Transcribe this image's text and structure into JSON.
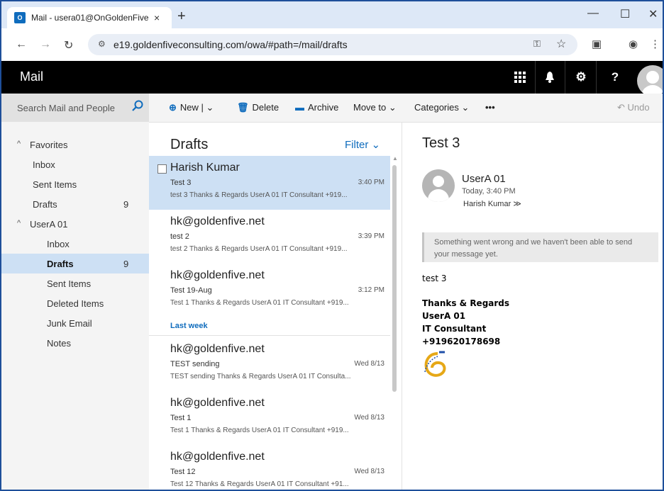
{
  "browser": {
    "tab_title": "Mail - usera01@OnGoldenFive",
    "tab_favicon_text": "O",
    "new_tab": "+",
    "close_tab": "×",
    "window_controls": [
      "—",
      "☐",
      "✕"
    ],
    "url": "e19.goldenfiveconsulting.com/owa/#path=/mail/drafts"
  },
  "app": {
    "brand": "Mail",
    "header_icons": [
      "apps-icon",
      "bell-icon",
      "gear-icon",
      "help-icon"
    ],
    "help_label": "?"
  },
  "search": {
    "placeholder": "Search Mail and People"
  },
  "folders": {
    "favorites_label": "Favorites",
    "favorites": [
      {
        "label": "Inbox",
        "count": ""
      },
      {
        "label": "Sent Items",
        "count": ""
      },
      {
        "label": "Drafts",
        "count": "9"
      }
    ],
    "account_label": "UserA 01",
    "account_folders": [
      {
        "label": "Inbox",
        "count": ""
      },
      {
        "label": "Drafts",
        "count": "9"
      },
      {
        "label": "Sent Items",
        "count": ""
      },
      {
        "label": "Deleted Items",
        "count": ""
      },
      {
        "label": "Junk Email",
        "count": ""
      },
      {
        "label": "Notes",
        "count": ""
      }
    ]
  },
  "commands": {
    "new": "New",
    "delete": "Delete",
    "archive": "Archive",
    "move_to": "Move to",
    "categories": "Categories",
    "more": "•••",
    "undo": "Undo"
  },
  "list": {
    "title": "Drafts",
    "filter": "Filter",
    "group_last_week": "Last week",
    "messages": [
      {
        "sender": "Harish Kumar",
        "subject": "Test 3",
        "time": "3:40 PM",
        "preview": "test 3 Thanks & Regards UserA 01 IT Consultant +919..."
      },
      {
        "sender": "hk@goldenfive.net",
        "subject": "test 2",
        "time": "3:39 PM",
        "preview": "test 2 Thanks & Regards UserA 01 IT Consultant +919..."
      },
      {
        "sender": "hk@goldenfive.net",
        "subject": "Test 19-Aug",
        "time": "3:12 PM",
        "preview": "Test 1 Thanks & Regards UserA 01 IT Consultant +919..."
      },
      {
        "sender": "hk@goldenfive.net",
        "subject": "TEST sending",
        "time": "Wed 8/13",
        "preview": "TEST sending Thanks & Regards UserA 01 IT Consulta..."
      },
      {
        "sender": "hk@goldenfive.net",
        "subject": "Test 1",
        "time": "Wed 8/13",
        "preview": "Test 1 Thanks & Regards UserA 01 IT Consultant +919..."
      },
      {
        "sender": "hk@goldenfive.net",
        "subject": "Test 12",
        "time": "Wed 8/13",
        "preview": "Test 12 Thanks & Regards UserA 01 IT Consultant +91..."
      }
    ]
  },
  "reading": {
    "subject": "Test 3",
    "from": "UserA 01",
    "sent_time": "Today, 3:40 PM",
    "to": "Harish Kumar",
    "warning": "Something went wrong and we haven't been able to send your message yet.",
    "body": "test 3",
    "signature": [
      "Thanks & Regards",
      "UserA 01",
      "IT Consultant",
      "+919620178698"
    ]
  },
  "colors": {
    "accent": "#0f6cbd",
    "selected_bg": "#cde0f4",
    "header_bg": "#000000"
  }
}
